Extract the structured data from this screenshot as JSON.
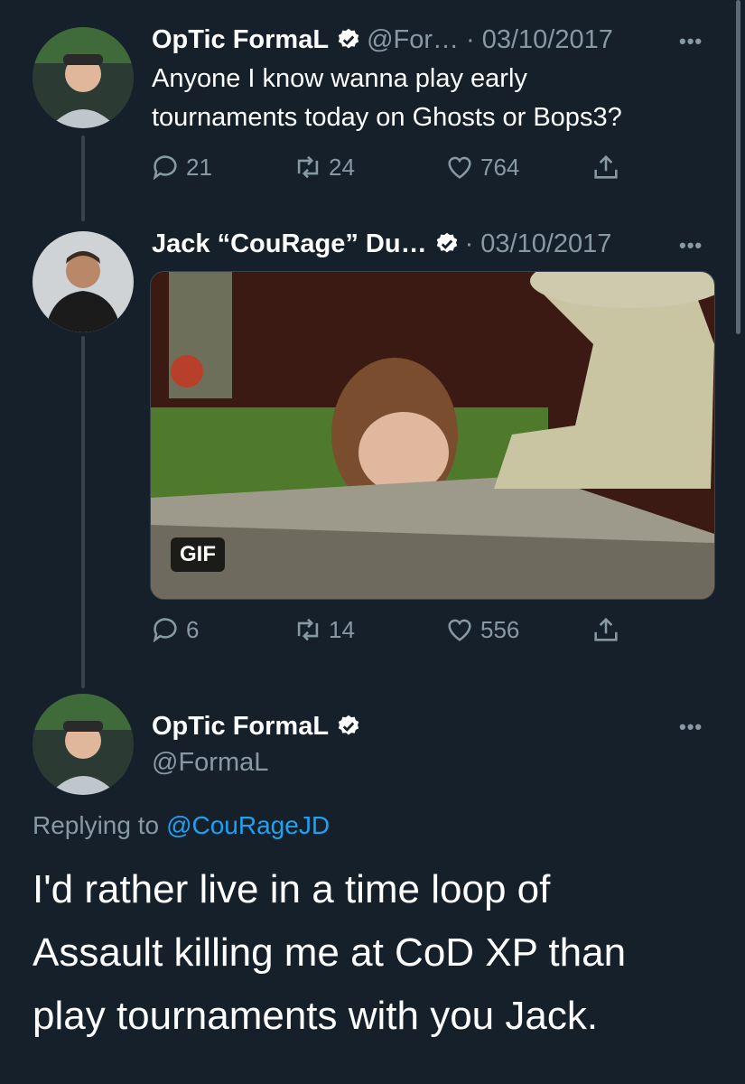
{
  "tweets": [
    {
      "name": "OpTic FormaL",
      "handle": "@For…",
      "date": "· 03/10/2017",
      "text_lines": [
        "Anyone I know wanna play early",
        "tournaments today on Ghosts or Bops3?"
      ],
      "replies": "21",
      "retweets": "24",
      "likes": "764"
    },
    {
      "name": "Jack “CouRage” Du…",
      "date": "· 03/10/2017",
      "media_badge": "GIF",
      "replies": "6",
      "retweets": "14",
      "likes": "556"
    }
  ],
  "focused": {
    "name": "OpTic FormaL",
    "handle": "@FormaL",
    "replying_prefix": "Replying to",
    "replying_to": "@CouRageJD",
    "text_lines": [
      "I'd rather live in a time loop of",
      "Assault killing me at CoD XP than",
      "play tournaments with you Jack."
    ]
  },
  "more_glyph": "•••",
  "colors": {
    "background": "#15202b",
    "muted": "#8899a6",
    "link": "#1da1f2",
    "thread_line": "#38444d"
  },
  "icons": [
    "verified-badge-icon",
    "reply-icon",
    "retweet-icon",
    "like-icon",
    "share-icon",
    "more-icon"
  ]
}
